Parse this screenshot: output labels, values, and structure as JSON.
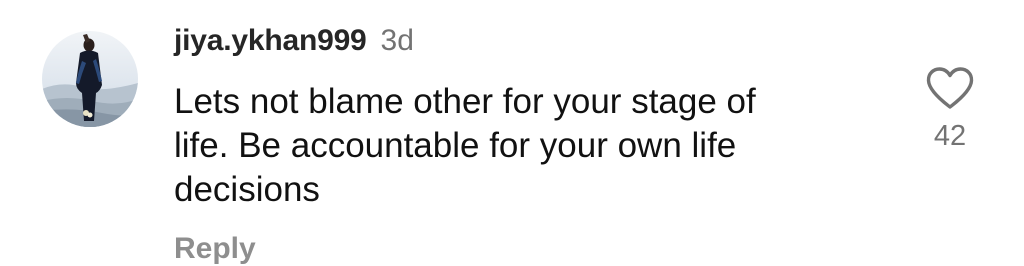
{
  "comment": {
    "username": "jiya.ykhan999",
    "timestamp": "3d",
    "text_lines": [
      "Lets not blame other for your stage of",
      "life. Be accountable for your own life",
      "decisions"
    ],
    "reply_label": "Reply",
    "like_count": "42",
    "like_icon": "heart-outline-icon"
  },
  "colors": {
    "username": "#262626",
    "secondary": "#737373",
    "reply": "#8e8e8e",
    "text": "#111111"
  }
}
